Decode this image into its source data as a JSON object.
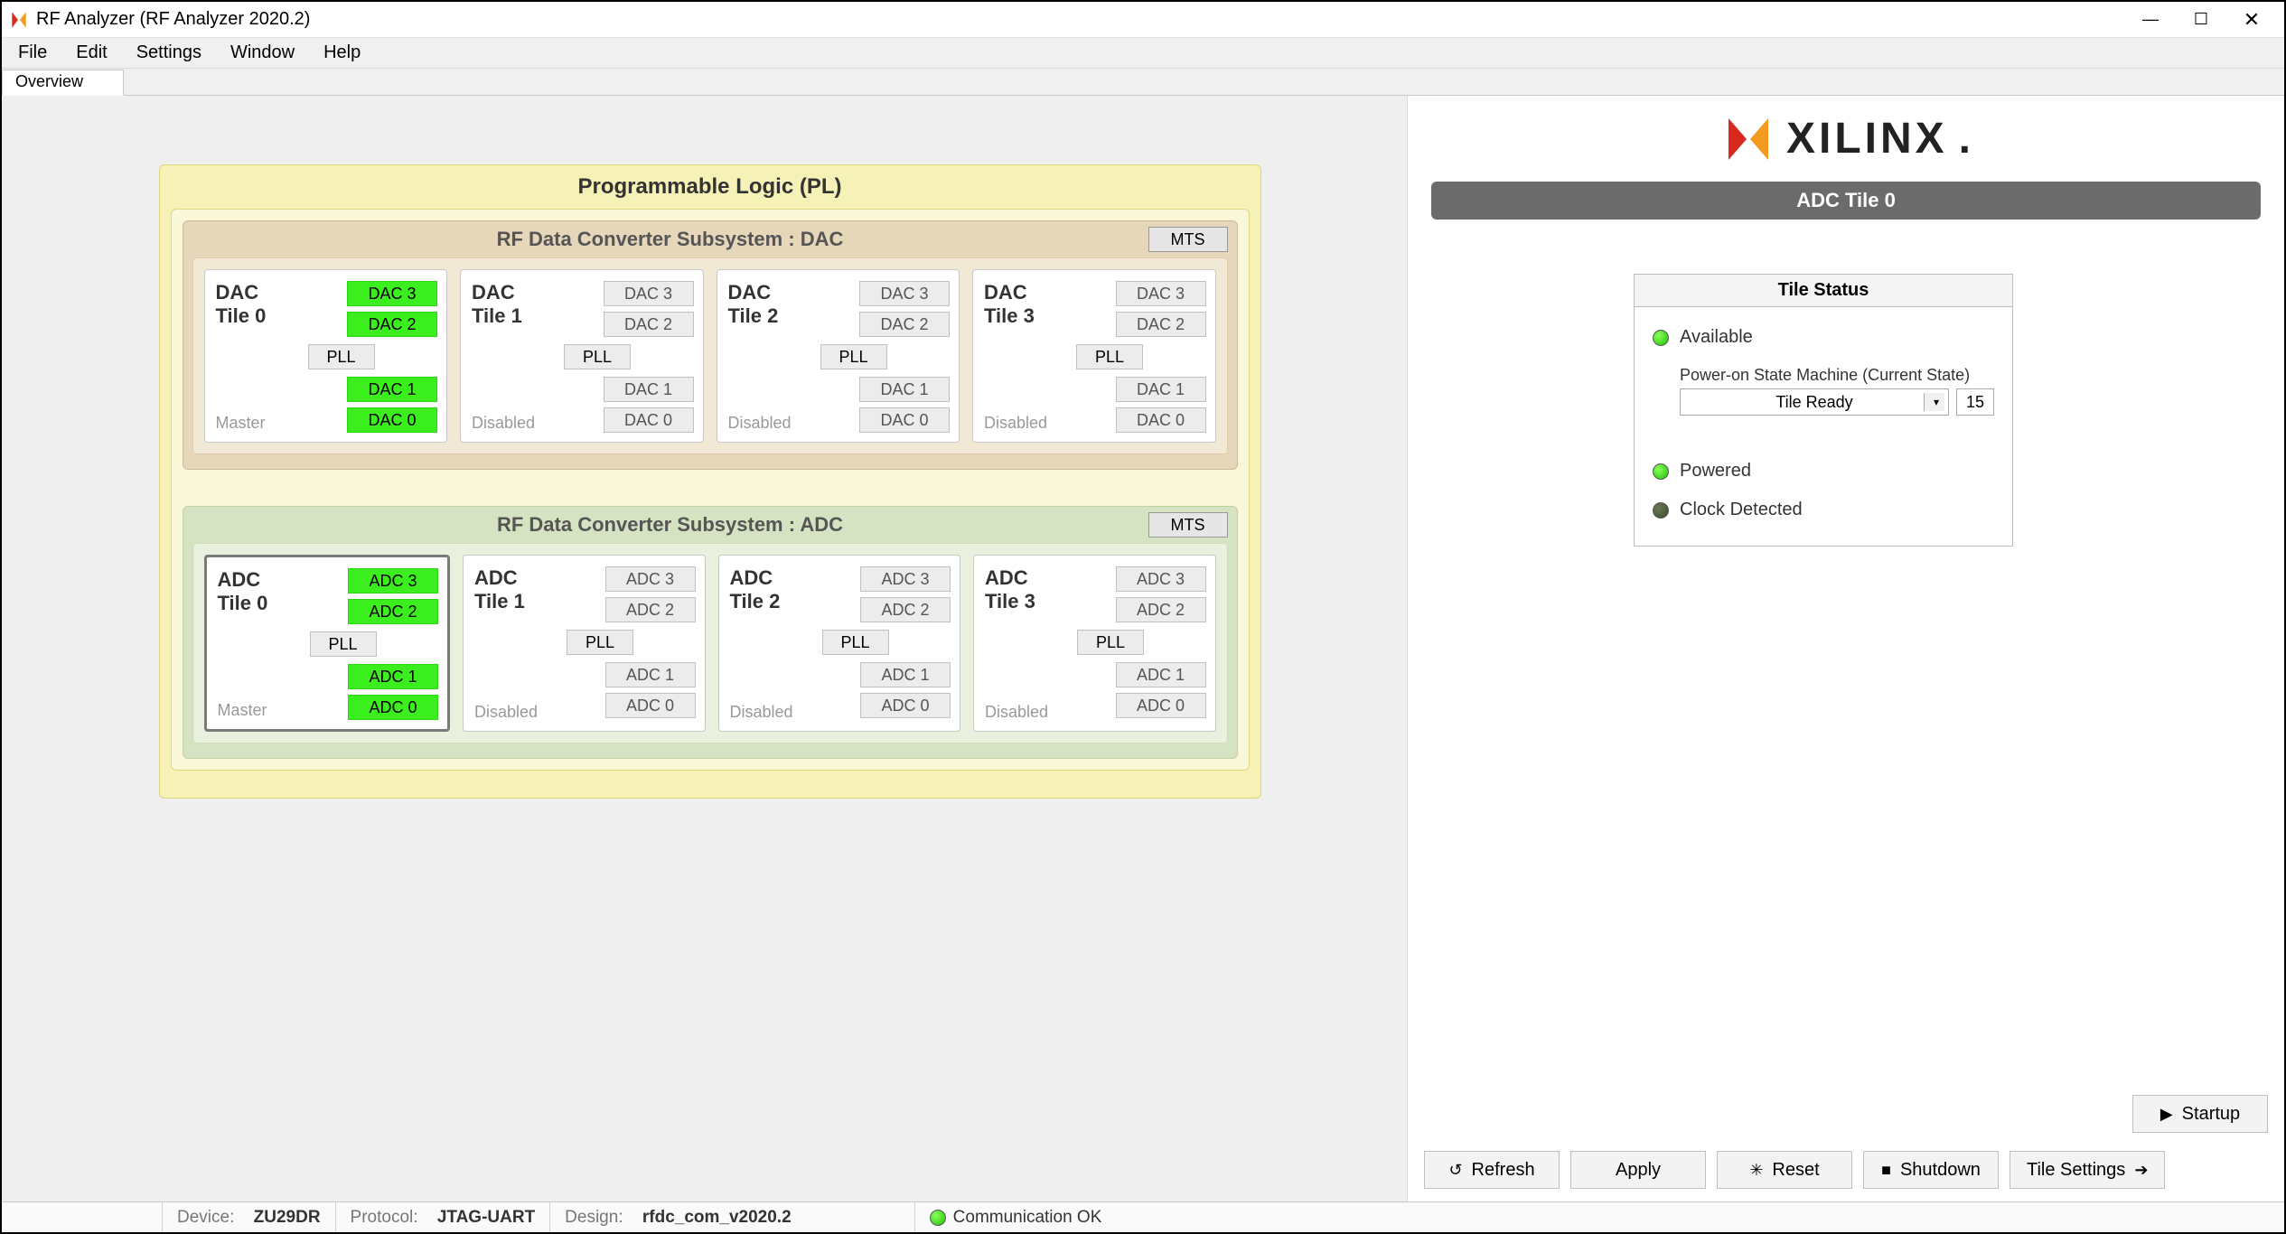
{
  "window": {
    "title": "RF Analyzer (RF Analyzer 2020.2)"
  },
  "menu": {
    "file": "File",
    "edit": "Edit",
    "settings": "Settings",
    "window": "Window",
    "help": "Help"
  },
  "tabs": {
    "overview": "Overview"
  },
  "pl": {
    "title": "Programmable Logic (PL)",
    "dac": {
      "title": "RF Data Converter Subsystem : DAC",
      "mts": "MTS",
      "tiles": [
        {
          "name": "DAC Tile 0",
          "status": "Master",
          "pll": "PLL",
          "channels": [
            "DAC 3",
            "DAC 2",
            "DAC 1",
            "DAC 0"
          ],
          "active": true
        },
        {
          "name": "DAC Tile 1",
          "status": "Disabled",
          "pll": "PLL",
          "channels": [
            "DAC 3",
            "DAC 2",
            "DAC 1",
            "DAC 0"
          ],
          "active": false
        },
        {
          "name": "DAC Tile 2",
          "status": "Disabled",
          "pll": "PLL",
          "channels": [
            "DAC 3",
            "DAC 2",
            "DAC 1",
            "DAC 0"
          ],
          "active": false
        },
        {
          "name": "DAC Tile 3",
          "status": "Disabled",
          "pll": "PLL",
          "channels": [
            "DAC 3",
            "DAC 2",
            "DAC 1",
            "DAC 0"
          ],
          "active": false
        }
      ]
    },
    "adc": {
      "title": "RF Data Converter Subsystem : ADC",
      "mts": "MTS",
      "tiles": [
        {
          "name": "ADC Tile 0",
          "status": "Master",
          "pll": "PLL",
          "channels": [
            "ADC 3",
            "ADC 2",
            "ADC 1",
            "ADC 0"
          ],
          "active": true
        },
        {
          "name": "ADC Tile 1",
          "status": "Disabled",
          "pll": "PLL",
          "channels": [
            "ADC 3",
            "ADC 2",
            "ADC 1",
            "ADC 0"
          ],
          "active": false
        },
        {
          "name": "ADC Tile 2",
          "status": "Disabled",
          "pll": "PLL",
          "channels": [
            "ADC 3",
            "ADC 2",
            "ADC 1",
            "ADC 0"
          ],
          "active": false
        },
        {
          "name": "ADC Tile 3",
          "status": "Disabled",
          "pll": "PLL",
          "channels": [
            "ADC 3",
            "ADC 2",
            "ADC 1",
            "ADC 0"
          ],
          "active": false
        }
      ]
    }
  },
  "right": {
    "brand": "XILINX",
    "tile_heading": "ADC Tile 0",
    "status_title": "Tile Status",
    "available": "Available",
    "sm_label": "Power-on State Machine (Current State)",
    "sm_value": "Tile Ready",
    "sm_num": "15",
    "powered": "Powered",
    "clock_detected": "Clock Detected"
  },
  "buttons": {
    "startup": "Startup",
    "refresh": "Refresh",
    "apply": "Apply",
    "reset": "Reset",
    "shutdown": "Shutdown",
    "tile_settings": "Tile Settings"
  },
  "statusbar": {
    "device_label": "Device:",
    "device": "ZU29DR",
    "protocol_label": "Protocol:",
    "protocol": "JTAG-UART",
    "design_label": "Design:",
    "design": "rfdc_com_v2020.2",
    "comm": "Communication OK"
  },
  "colors": {
    "accent_green": "#3bef1e",
    "brand_red": "#d9281d",
    "brand_orange": "#f39a1f"
  }
}
